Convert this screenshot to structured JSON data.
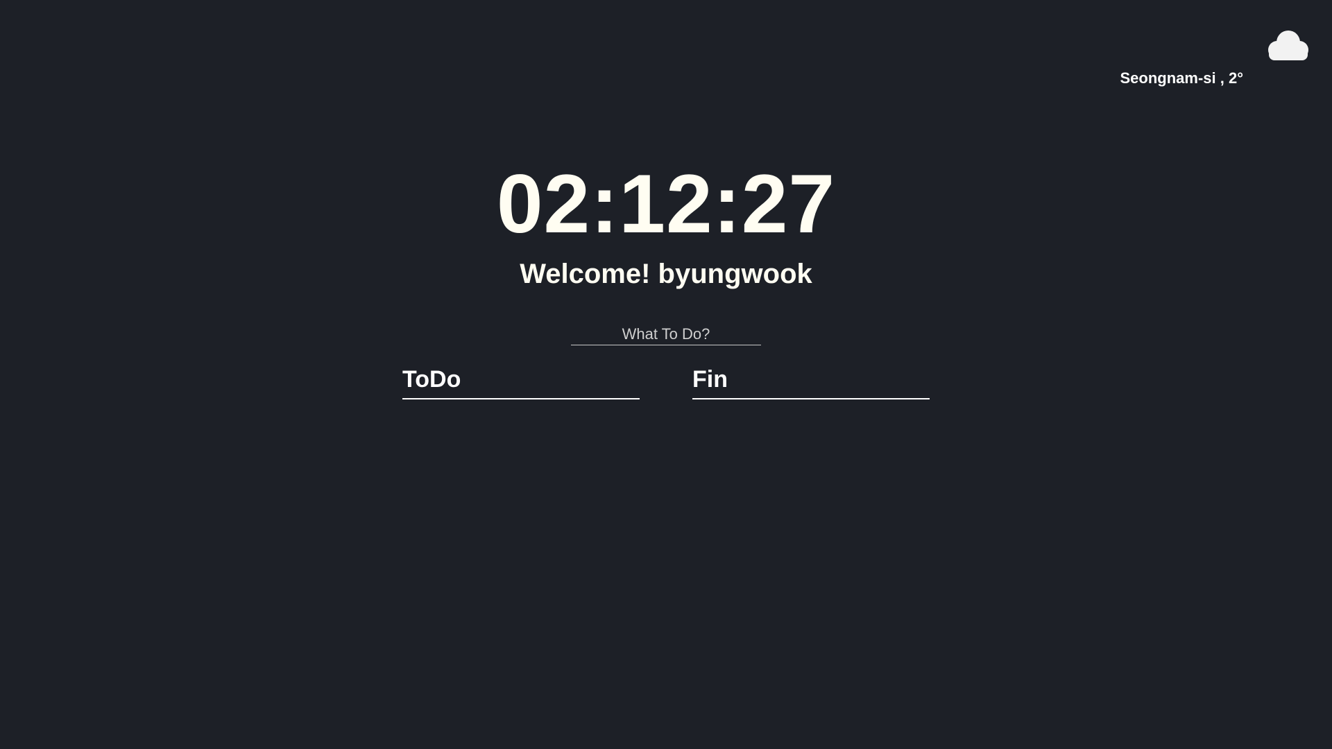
{
  "weather": {
    "icon": "cloud-icon",
    "location_temp": "Seongnam-si , 2°"
  },
  "clock": {
    "time": "02:12:27"
  },
  "greeting": {
    "text": "Welcome! byungwook"
  },
  "todo_form": {
    "placeholder": "What To Do?",
    "value": ""
  },
  "lists": {
    "todo": {
      "title": "ToDo",
      "items": []
    },
    "fin": {
      "title": "Fin",
      "items": []
    }
  },
  "colors": {
    "background": "#1d2027",
    "text": "#fffdf2",
    "cloud": "#f2f2f2"
  }
}
